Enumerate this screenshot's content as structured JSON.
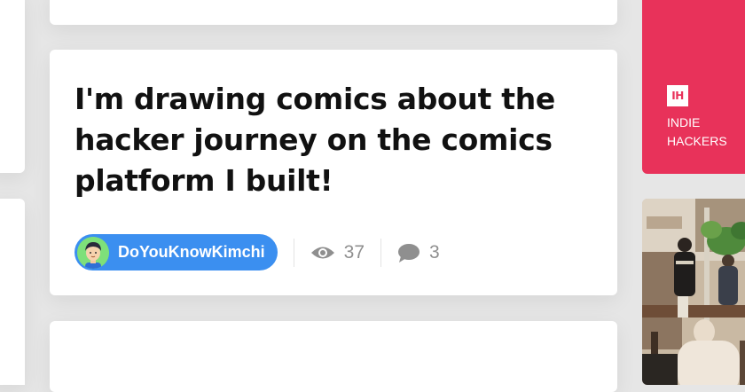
{
  "post": {
    "title": "I'm drawing comics about the hacker journey on the comics platform I built!",
    "author": "DoYouKnowKimchi",
    "views": "37",
    "comments": "3"
  },
  "icons": {
    "views": "eye-icon",
    "comments": "speech-bubble-icon"
  },
  "brand": {
    "logo": "IH",
    "name_line1": "INDIE",
    "name_line2": "HACKERS",
    "color": "#e8325a"
  },
  "colors": {
    "author_pill": "#3b8ff0",
    "background": "#e6e6e6",
    "stat_text": "#8f8f8f"
  }
}
